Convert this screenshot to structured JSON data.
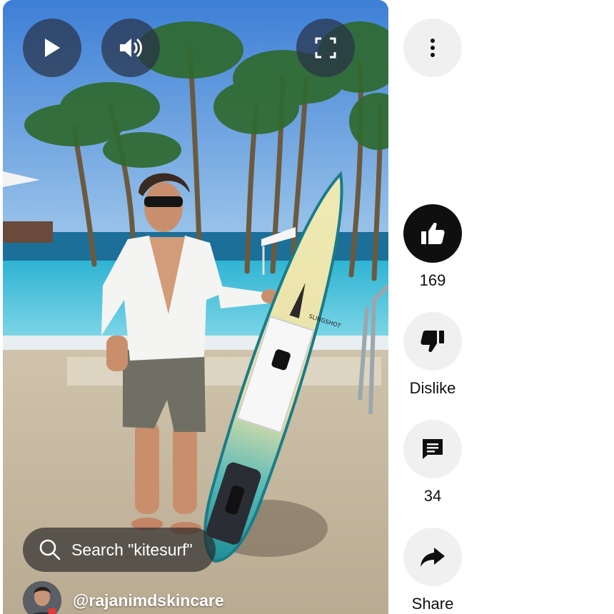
{
  "player": {
    "play_icon": "play-icon",
    "volume_icon": "volume-icon",
    "fullscreen_icon": "fullscreen-icon",
    "search_chip": {
      "label": "Search \"kitesurf\"",
      "icon": "search-icon"
    },
    "channel": {
      "handle": "@rajanimdskincare"
    },
    "board_brand": "SLINGSHOT"
  },
  "actions": {
    "more_icon": "more-vert-icon",
    "like": {
      "count": "169",
      "icon": "thumb-up-icon",
      "active": true
    },
    "dislike": {
      "label": "Dislike",
      "icon": "thumb-down-icon"
    },
    "comments": {
      "count": "34",
      "icon": "comment-icon"
    },
    "share": {
      "label": "Share",
      "icon": "share-icon"
    }
  },
  "colors": {
    "rail_button_bg": "#f0f0f0",
    "like_active_bg": "#0f0f0f",
    "overlay_button_bg": "#28324"
  }
}
